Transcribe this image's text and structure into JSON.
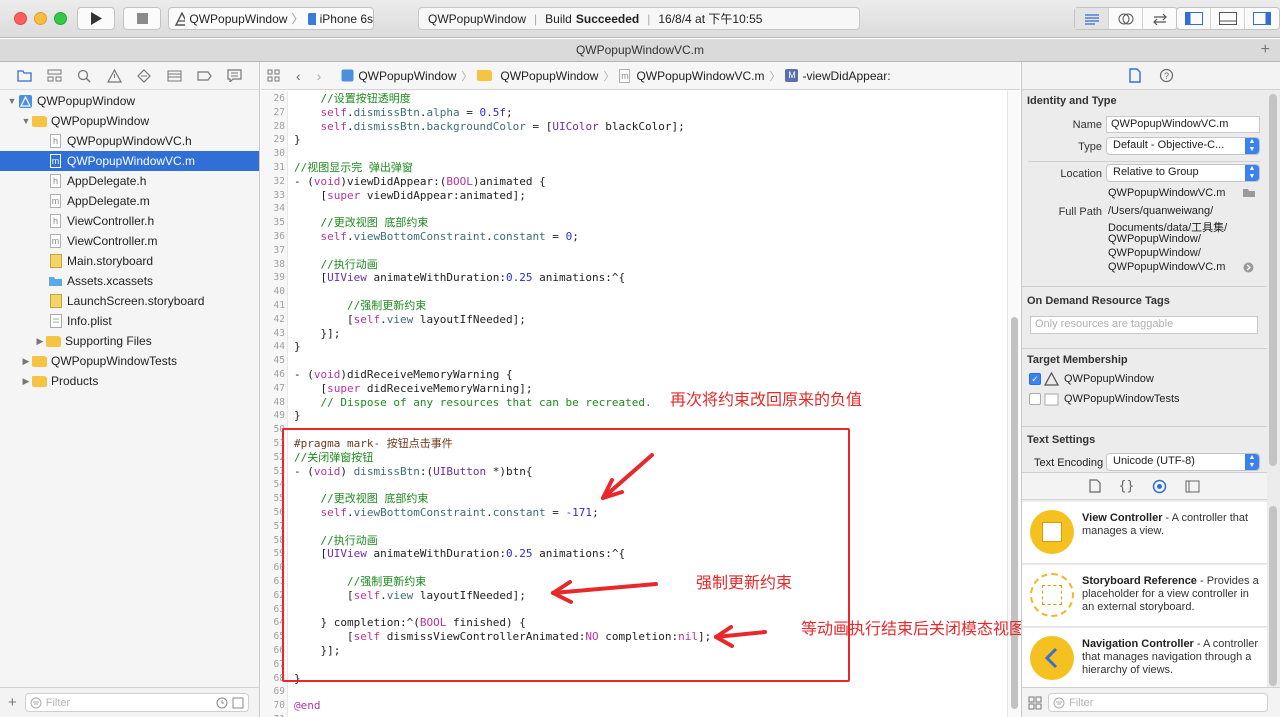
{
  "toolbar": {
    "scheme_app": "QWPopupWindow",
    "scheme_device": "iPhone 6s",
    "activity_project": "QWPopupWindow",
    "activity_status_prefix": "Build",
    "activity_status": "Succeeded",
    "activity_time": "16/8/4 at 下午10:55"
  },
  "tab": {
    "title": "QWPopupWindowVC.m",
    "plus": "+"
  },
  "navigator": {
    "project": "QWPopupWindow",
    "group": "QWPopupWindow",
    "files": [
      {
        "name": "QWPopupWindowVC.h",
        "kind": "h"
      },
      {
        "name": "QWPopupWindowVC.m",
        "kind": "m"
      },
      {
        "name": "AppDelegate.h",
        "kind": "h"
      },
      {
        "name": "AppDelegate.m",
        "kind": "m"
      },
      {
        "name": "ViewController.h",
        "kind": "h"
      },
      {
        "name": "ViewController.m",
        "kind": "m"
      },
      {
        "name": "Main.storyboard",
        "kind": "storyboard"
      },
      {
        "name": "Assets.xcassets",
        "kind": "assets"
      },
      {
        "name": "LaunchScreen.storyboard",
        "kind": "storyboard"
      },
      {
        "name": "Info.plist",
        "kind": "plist"
      }
    ],
    "supporting": "Supporting Files",
    "tests": "QWPopupWindowTests",
    "products": "Products",
    "filter_placeholder": "Filter"
  },
  "jumpbar": {
    "project": "QWPopupWindow",
    "group": "QWPopupWindow",
    "file": "QWPopupWindowVC.m",
    "method_badge": "M",
    "method": "-viewDidAppear:"
  },
  "code": {
    "lines": [
      {
        "n": "26",
        "t": "    //设置按钮透明度"
      },
      {
        "n": "27",
        "t": "    self.dismissBtn.alpha = 0.5f;"
      },
      {
        "n": "28",
        "t": "    self.dismissBtn.backgroundColor = [UIColor blackColor];"
      },
      {
        "n": "29",
        "t": "}"
      },
      {
        "n": "30",
        "t": ""
      },
      {
        "n": "31",
        "t": "//视图显示完 弹出弹窗"
      },
      {
        "n": "32",
        "t": "- (void)viewDidAppear:(BOOL)animated {"
      },
      {
        "n": "33",
        "t": "    [super viewDidAppear:animated];"
      },
      {
        "n": "34",
        "t": ""
      },
      {
        "n": "35",
        "t": "    //更改视图 底部约束"
      },
      {
        "n": "36",
        "t": "    self.viewBottomConstraint.constant = 0;"
      },
      {
        "n": "37",
        "t": ""
      },
      {
        "n": "38",
        "t": "    //执行动画"
      },
      {
        "n": "39",
        "t": "    [UIView animateWithDuration:0.25 animations:^{"
      },
      {
        "n": "40",
        "t": ""
      },
      {
        "n": "41",
        "t": "        //强制更新约束"
      },
      {
        "n": "42",
        "t": "        [self.view layoutIfNeeded];"
      },
      {
        "n": "43",
        "t": "    }];"
      },
      {
        "n": "44",
        "t": "}"
      },
      {
        "n": "45",
        "t": ""
      },
      {
        "n": "46",
        "t": "- (void)didReceiveMemoryWarning {"
      },
      {
        "n": "47",
        "t": "    [super didReceiveMemoryWarning];"
      },
      {
        "n": "48",
        "t": "    // Dispose of any resources that can be recreated."
      },
      {
        "n": "49",
        "t": "}"
      },
      {
        "n": "50",
        "t": ""
      },
      {
        "n": "51",
        "t": "#pragma mark- 按钮点击事件"
      },
      {
        "n": "52",
        "t": "//关闭弹窗按钮"
      },
      {
        "n": "53",
        "t": "- (void) dismissBtn:(UIButton *)btn{"
      },
      {
        "n": "54",
        "t": ""
      },
      {
        "n": "55",
        "t": "    //更改视图 底部约束"
      },
      {
        "n": "56",
        "t": "    self.viewBottomConstraint.constant = -171;"
      },
      {
        "n": "57",
        "t": ""
      },
      {
        "n": "58",
        "t": "    //执行动画"
      },
      {
        "n": "59",
        "t": "    [UIView animateWithDuration:0.25 animations:^{"
      },
      {
        "n": "60",
        "t": ""
      },
      {
        "n": "61",
        "t": "        //强制更新约束"
      },
      {
        "n": "62",
        "t": "        [self.view layoutIfNeeded];"
      },
      {
        "n": "63",
        "t": ""
      },
      {
        "n": "64",
        "t": "    } completion:^(BOOL finished) {"
      },
      {
        "n": "65",
        "t": "        [self dismissViewControllerAnimated:NO completion:nil];"
      },
      {
        "n": "66",
        "t": "    }];"
      },
      {
        "n": "67",
        "t": ""
      },
      {
        "n": "68",
        "t": "}"
      },
      {
        "n": "69",
        "t": ""
      },
      {
        "n": "70",
        "t": "@end"
      },
      {
        "n": "71",
        "t": ""
      }
    ]
  },
  "annotations": {
    "a1": "再次将约束改回原来的负值",
    "a2": "强制更新约束",
    "a3": "等动画执行结束后关闭模态视图"
  },
  "inspector": {
    "identity_title": "Identity and Type",
    "name_label": "Name",
    "name_value": "QWPopupWindowVC.m",
    "type_label": "Type",
    "type_value": "Default - Objective-C...",
    "location_label": "Location",
    "location_value": "Relative to Group",
    "location_file": "QWPopupWindowVC.m",
    "fullpath_label": "Full Path",
    "fullpath_lines": [
      "/Users/quanweiwang/",
      "Documents/data/工具集/",
      "QWPopupWindow/",
      "QWPopupWindow/",
      "QWPopupWindowVC.m"
    ],
    "odr_title": "On Demand Resource Tags",
    "odr_placeholder": "Only resources are taggable",
    "target_title": "Target Membership",
    "targets": [
      {
        "name": "QWPopupWindow",
        "checked": true
      },
      {
        "name": "QWPopupWindowTests",
        "checked": false
      }
    ],
    "text_title": "Text Settings",
    "encoding_label": "Text Encoding",
    "encoding_value": "Unicode (UTF-8)",
    "library": [
      {
        "title": "View Controller",
        "desc": " - A controller that manages a view."
      },
      {
        "title": "Storyboard Reference",
        "desc": " - Provides a placeholder for a view controller in an external storyboard."
      },
      {
        "title": "Navigation Controller",
        "desc": " - A controller that manages navigation through a hierarchy of views."
      }
    ],
    "filter_placeholder": "Filter"
  },
  "colors": {
    "selection": "#2f6fd6",
    "annotation_red": "#e8282a",
    "comment_green": "#1e8a1e",
    "keyword_pink": "#b5359b",
    "number_blue": "#2d2fc9"
  }
}
